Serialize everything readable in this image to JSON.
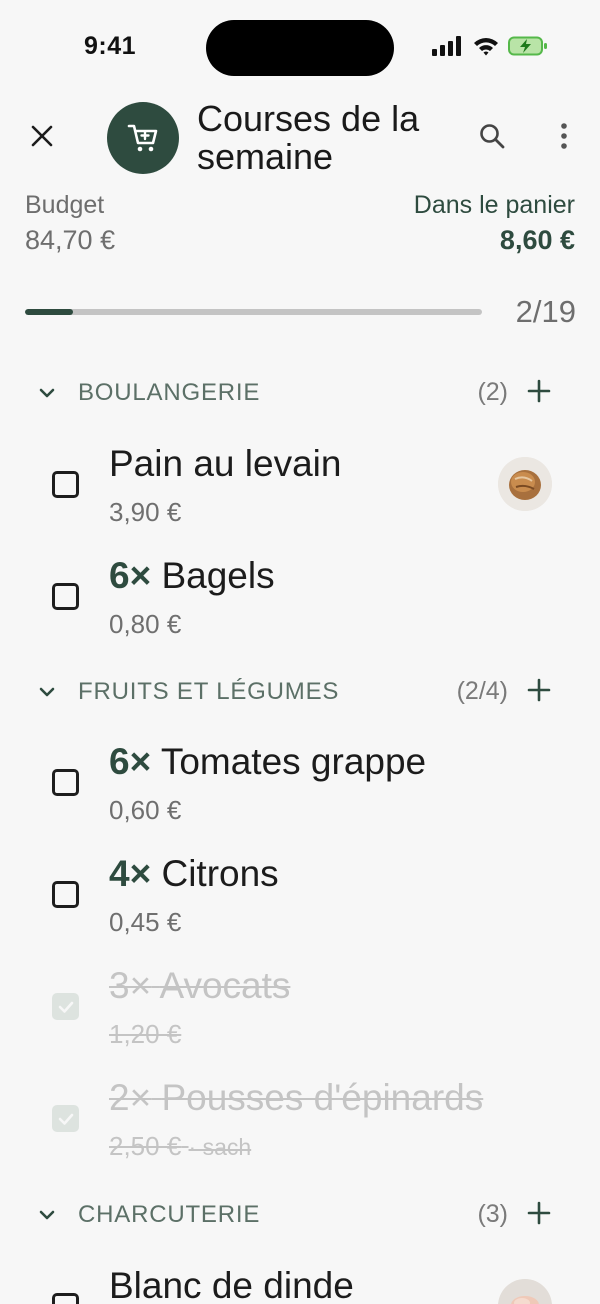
{
  "status_bar": {
    "time": "9:41",
    "icons": [
      "signal-icon",
      "wifi-icon",
      "battery-charging-icon"
    ]
  },
  "header": {
    "title": "Courses de la semaine",
    "close_icon": "close-icon",
    "avatar_icon": "shopping-cart-icon",
    "search_icon": "search-icon",
    "more_icon": "more-vertical-icon"
  },
  "summary": {
    "budget_label": "Budget",
    "budget_value": "84,70 €",
    "cart_label": "Dans le panier",
    "cart_value": "8,60 €",
    "progress_text": "2/19",
    "progress_fraction": 0.105
  },
  "colors": {
    "accent": "#2e4b3f",
    "background": "#f7f7f7",
    "muted": "#6e6e6e",
    "done": "#c4c4c4"
  },
  "sections": [
    {
      "title": "BOULANGERIE",
      "count": "(2)",
      "items": [
        {
          "qty": "",
          "name": "Pain au levain",
          "price": "3,90 €",
          "unit": "",
          "checked": false,
          "thumb": "bread-photo"
        },
        {
          "qty": "6×",
          "name": "Bagels",
          "price": "0,80 €",
          "unit": "",
          "checked": false,
          "thumb": ""
        }
      ]
    },
    {
      "title": "FRUITS ET LÉGUMES",
      "count": "(2/4)",
      "items": [
        {
          "qty": "6×",
          "name": "Tomates grappe",
          "price": "0,60 €",
          "unit": "",
          "checked": false,
          "thumb": ""
        },
        {
          "qty": "4×",
          "name": "Citrons",
          "price": "0,45 €",
          "unit": "",
          "checked": false,
          "thumb": ""
        },
        {
          "qty": "3×",
          "name": "Avocats",
          "price": "1,20 €",
          "unit": "",
          "checked": true,
          "thumb": ""
        },
        {
          "qty": "2×",
          "name": "Pousses d'épinards",
          "price": "2,50 €",
          "unit": "· sach",
          "checked": true,
          "thumb": ""
        }
      ]
    },
    {
      "title": "CHARCUTERIE",
      "count": "(3)",
      "items": [
        {
          "qty": "",
          "name": "Blanc de dinde",
          "price": "",
          "unit": "",
          "checked": false,
          "thumb": "turkey-photo"
        }
      ]
    }
  ]
}
